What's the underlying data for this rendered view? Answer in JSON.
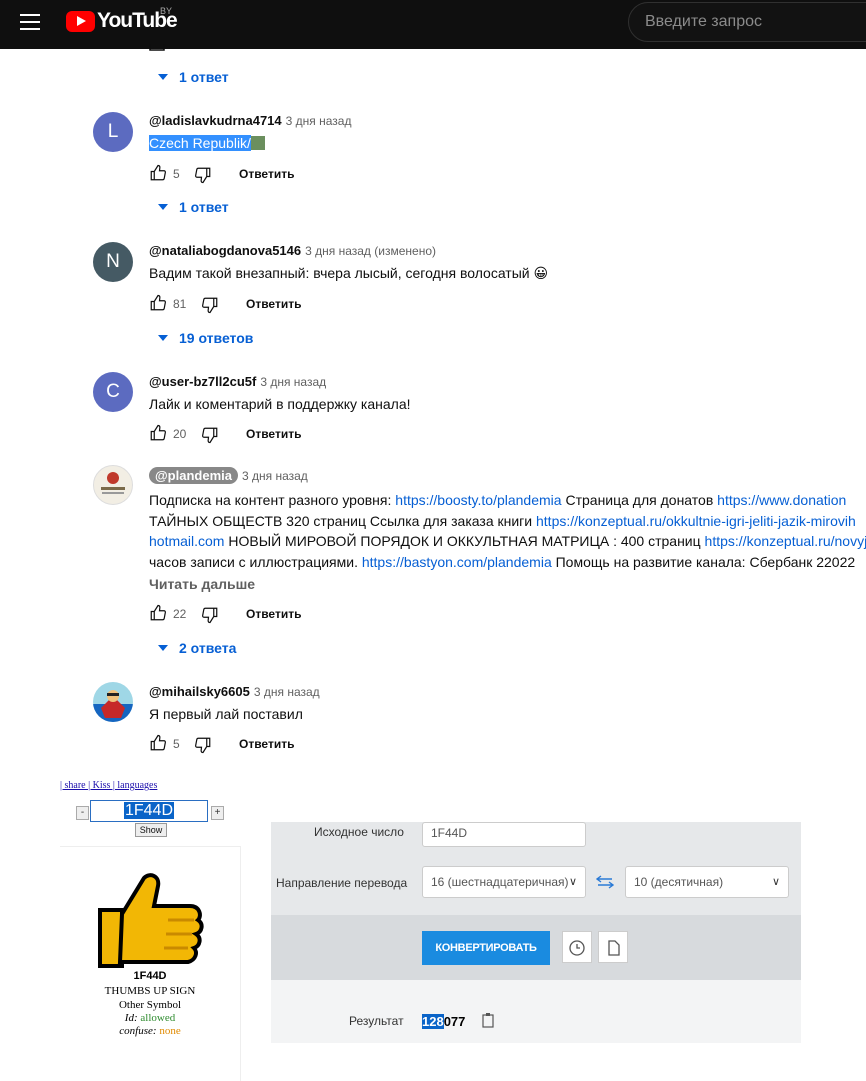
{
  "header": {
    "logo_text": "YouTube",
    "country": "BY",
    "search_placeholder": "Введите запрос"
  },
  "replies_top": "1 ответ",
  "comments": [
    {
      "initial": "L",
      "author": "@ladislavkudrna4714",
      "time": "3 дня назад",
      "text": "Czech Republik/",
      "likes": "5",
      "reply": "Ответить",
      "replies": "1 ответ",
      "avatar_color": "#5c6bc0"
    },
    {
      "initial": "N",
      "author": "@nataliabogdanova5146",
      "time": "3 дня назад (изменено)",
      "text": "Вадим такой внезапный: вчера лысый, сегодня волосатый",
      "emoji": "😀",
      "likes": "81",
      "reply": "Ответить",
      "replies": "19 ответов",
      "avatar_color": "#455a64"
    },
    {
      "initial": "C",
      "author": "@user-bz7ll2cu5f",
      "time": "3 дня назад",
      "text": "Лайк и коментарий в поддержку канала!",
      "likes": "20",
      "reply": "Ответить",
      "avatar_color": "#5c6bc0"
    },
    {
      "author": "@plandemia",
      "time": "3 дня назад",
      "lines": [
        {
          "a": "Подписка  на контент разного уровня: ",
          "link": "https://boosty.to/plandemia",
          "b": " Страница  для донатов ",
          "link2": "https://www.donation"
        },
        {
          "a": "ТАЙНЫХ ОБЩЕСТВ  320 страниц Ссылка для заказа книги  ",
          "link": "https://konzeptual.ru/okkultnie-igri-jeliti-jazik-mirovih"
        },
        {
          "link": "hotmail.com",
          "b": " НОВЫЙ МИРОВОЙ ПОРЯДОК И ОККУЛЬТНАЯ МАТРИЦА : 400 страниц ",
          "link2": "https://konzeptual.ru/novyj-"
        },
        {
          "a": "часов записи с иллюстрациями. ",
          "link": "https://bastyon.com/plandemia",
          "b": " Помощь на развитие канала: Сбербанк 22022"
        }
      ],
      "read_more": "Читать дальше",
      "likes": "22",
      "reply": "Ответить",
      "replies": "2 ответа"
    },
    {
      "author": "@mihailsky6605",
      "time": "3 дня назад",
      "text": "Я первый лай поставил",
      "likes": "5",
      "reply": "Ответить"
    }
  ],
  "codepoint": {
    "top_links": "| share | Kiss | languages",
    "value": "1F44D",
    "show": "Show",
    "code": "1F44D",
    "name": "THUMBS UP SIGN",
    "category": "Other Symbol",
    "id_label": "Id:",
    "id_value": "allowed",
    "confuse_label": "confuse:",
    "confuse_value": "none"
  },
  "converter": {
    "source_label": "Исходное число",
    "source_value": "1F44D",
    "direction_label": "Направление перевода",
    "from": "16 (шестнадцатеричная)",
    "to": "10 (десятичная)",
    "convert_btn": "КОНВЕРТИРОВАТЬ",
    "result_label": "Результат",
    "result_sel": "128",
    "result_rest": "077"
  }
}
